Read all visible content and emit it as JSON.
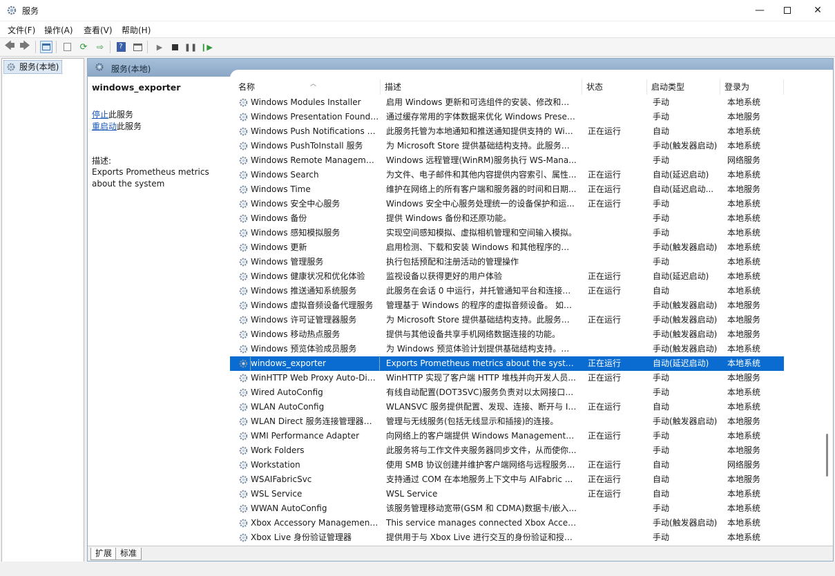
{
  "window": {
    "title": "服务"
  },
  "menu": [
    "文件(F)",
    "操作(A)",
    "查看(V)",
    "帮助(H)"
  ],
  "tree": {
    "label": "服务(本地)"
  },
  "main": {
    "header": "服务(本地)",
    "selected_service": "windows_exporter",
    "stop_link": "停止",
    "stop_suffix": "此服务",
    "restart_link": "重启动",
    "restart_suffix": "此服务",
    "desc_label": "描述:",
    "desc_text": "Exports Prometheus metrics about the system"
  },
  "columns": {
    "name": "名称",
    "desc": "描述",
    "status": "状态",
    "start": "启动类型",
    "logon": "登录为"
  },
  "rows": [
    {
      "name": "Windows Modules Installer",
      "desc": "启用 Windows 更新和可选组件的安装、修改和移...",
      "status": "",
      "start": "手动",
      "logon": "本地系统"
    },
    {
      "name": "Windows Presentation Founda...",
      "desc": "通过缓存常用的字体数据来优化 Windows Presen...",
      "status": "",
      "start": "手动",
      "logon": "本地服务"
    },
    {
      "name": "Windows Push Notifications U...",
      "desc": "此服务托管为本地通知和推送通知提供支持的 Win...",
      "status": "正在运行",
      "start": "自动",
      "logon": "本地系统"
    },
    {
      "name": "Windows PushToInstall 服务",
      "desc": "为 Microsoft Store 提供基础结构支持。此服务自...",
      "status": "",
      "start": "手动(触发器启动)",
      "logon": "本地系统"
    },
    {
      "name": "Windows Remote Managemen...",
      "desc": "Windows 远程管理(WinRM)服务执行 WS-Mana...",
      "status": "",
      "start": "手动",
      "logon": "网络服务"
    },
    {
      "name": "Windows Search",
      "desc": "为文件、电子邮件和其他内容提供内容索引、属性...",
      "status": "正在运行",
      "start": "自动(延迟启动)",
      "logon": "本地系统"
    },
    {
      "name": "Windows Time",
      "desc": "维护在网络上的所有客户端和服务器的时间和日期...",
      "status": "正在运行",
      "start": "自动(延迟启动...",
      "logon": "本地服务"
    },
    {
      "name": "Windows 安全中心服务",
      "desc": "Windows 安全中心服务处理统一的设备保护和运...",
      "status": "正在运行",
      "start": "手动",
      "logon": "本地系统"
    },
    {
      "name": "Windows 备份",
      "desc": "提供 Windows 备份和还原功能。",
      "status": "",
      "start": "手动",
      "logon": "本地系统"
    },
    {
      "name": "Windows 感知模拟服务",
      "desc": "实现空间感知模拟、虚拟相机管理和空间输入模拟。",
      "status": "",
      "start": "手动",
      "logon": "本地系统"
    },
    {
      "name": "Windows 更新",
      "desc": "启用检测、下载和安装 Windows 和其他程序的更...",
      "status": "",
      "start": "手动(触发器启动)",
      "logon": "本地系统"
    },
    {
      "name": "Windows 管理服务",
      "desc": "执行包括预配和注册活动的管理操作",
      "status": "",
      "start": "手动",
      "logon": "本地系统"
    },
    {
      "name": "Windows 健康状况和优化体验",
      "desc": "监视设备以获得更好的用户体验",
      "status": "正在运行",
      "start": "自动(延迟启动)",
      "logon": "本地系统"
    },
    {
      "name": "Windows 推送通知系统服务",
      "desc": "此服务在会话 0 中运行，并托管通知平台和连接提...",
      "status": "正在运行",
      "start": "自动",
      "logon": "本地系统"
    },
    {
      "name": "Windows 虚拟音频设备代理服务",
      "desc": "管理基于 Windows 的程序的虚拟音频设备。 如果...",
      "status": "",
      "start": "手动(触发器启动)",
      "logon": "本地服务"
    },
    {
      "name": "Windows 许可证管理器服务",
      "desc": "为 Microsoft Store 提供基础结构支持。此服务按...",
      "status": "正在运行",
      "start": "手动(触发器启动)",
      "logon": "本地服务"
    },
    {
      "name": "Windows 移动热点服务",
      "desc": "提供与其他设备共享手机网络数据连接的功能。",
      "status": "",
      "start": "手动(触发器启动)",
      "logon": "本地服务"
    },
    {
      "name": "Windows 预览体验成员服务",
      "desc": "为 Windows 预览体验计划提供基础结构支持。此...",
      "status": "",
      "start": "手动(触发器启动)",
      "logon": "本地系统"
    },
    {
      "name": "windows_exporter",
      "desc": "Exports Prometheus metrics about the system",
      "status": "正在运行",
      "start": "自动(延迟启动)",
      "logon": "本地系统",
      "selected": true
    },
    {
      "name": "WinHTTP Web Proxy Auto-Disc...",
      "desc": "WinHTTP 实现了客户端 HTTP 堆栈并向开发人员...",
      "status": "正在运行",
      "start": "手动",
      "logon": "本地服务"
    },
    {
      "name": "Wired AutoConfig",
      "desc": "有线自动配置(DOT3SVC)服务负责对以太网接口执...",
      "status": "",
      "start": "手动",
      "logon": "本地系统"
    },
    {
      "name": "WLAN AutoConfig",
      "desc": "WLANSVC 服务提供配置、发现、连接、断开与 IE...",
      "status": "正在运行",
      "start": "自动",
      "logon": "本地系统"
    },
    {
      "name": "WLAN Direct 服务连接管理器服务",
      "desc": "管理与无线服务(包括无线显示和插接)的连接。",
      "status": "",
      "start": "手动(触发器启动)",
      "logon": "本地服务"
    },
    {
      "name": "WMI Performance Adapter",
      "desc": "向网络上的客户端提供 Windows Management I...",
      "status": "正在运行",
      "start": "手动",
      "logon": "本地系统"
    },
    {
      "name": "Work Folders",
      "desc": "此服务将与工作文件夹服务器同步文件，从而使你...",
      "status": "",
      "start": "手动",
      "logon": "本地服务"
    },
    {
      "name": "Workstation",
      "desc": "使用 SMB 协议创建并维护客户端网络与远程服务...",
      "status": "正在运行",
      "start": "自动",
      "logon": "网络服务"
    },
    {
      "name": "WSAIFabricSvc",
      "desc": "支持通过 COM 在本地服务上下文中与 AIFabric ...",
      "status": "正在运行",
      "start": "自动",
      "logon": "本地服务"
    },
    {
      "name": "WSL Service",
      "desc": "WSL Service",
      "status": "正在运行",
      "start": "自动",
      "logon": "本地系统"
    },
    {
      "name": "WWAN AutoConfig",
      "desc": "该服务管理移动宽带(GSM 和 CDMA)数据卡/嵌入...",
      "status": "",
      "start": "手动",
      "logon": "本地系统"
    },
    {
      "name": "Xbox Accessory Management ...",
      "desc": "This service manages connected Xbox Access...",
      "status": "",
      "start": "手动(触发器启动)",
      "logon": "本地系统"
    },
    {
      "name": "Xbox Live 身份验证管理器",
      "desc": "提供用于与 Xbox Live 进行交互的身份验证和授权...",
      "status": "",
      "start": "手动",
      "logon": "本地系统"
    }
  ],
  "tabs": [
    "扩展",
    "标准"
  ],
  "colors": {
    "selection": "#0a6cd1",
    "link": "#1a58b5",
    "header": "#8aa7c6"
  }
}
